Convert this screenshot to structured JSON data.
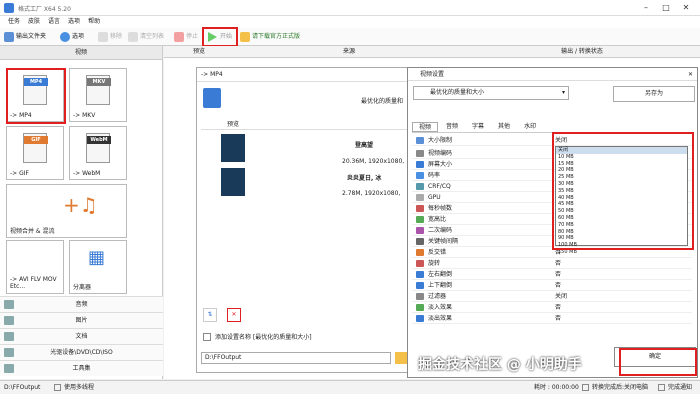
{
  "app": {
    "title": "格式工厂 X64 5.20"
  },
  "menu": [
    "任务",
    "皮肤",
    "语言",
    "选项",
    "帮助"
  ],
  "toolbar": {
    "output_folder": "输出文件夹",
    "options": "选项",
    "remove": "移除",
    "clear_list": "清空列表",
    "stop": "停止",
    "start": "开始",
    "download": "请下载官方正式版"
  },
  "left": {
    "header": "视频",
    "tiles": [
      "-> MP4",
      "-> MKV",
      "-> GIF",
      "-> WebM",
      "视频合并 & 混流",
      "-> AVI FLV MOV Etc...",
      "分离器"
    ],
    "tile_badges": [
      "MP4",
      "MKV",
      "GIF",
      "WebM"
    ],
    "categories": [
      "音频",
      "图片",
      "文档",
      "光驱设备\\DVD\\CD\\ISO",
      "工具集"
    ]
  },
  "main": {
    "col_preview": "预览",
    "col_source": "来源",
    "col_output": "输出 / 转换状态"
  },
  "panel": {
    "title": "-> MP4",
    "quality": "最优化的质量和",
    "preview_col": "预览",
    "items": [
      {
        "title": "登高望",
        "meta": "20.36M, 1920x1080,"
      },
      {
        "title": "炎炎夏日, 冰",
        "meta": "2.78M, 1920x1080,"
      }
    ],
    "setting_label": "添加设置名称 [最优化的质量和大小]",
    "output_path": "D:\\FFOutput"
  },
  "dialog": {
    "title": "视频设置",
    "preset": "最优化的质量和大小",
    "save_as": "另存为",
    "tabs": [
      "视频",
      "音频",
      "字幕",
      "其他",
      "水印"
    ],
    "ok": "确定",
    "props": [
      {
        "name": "大小限制",
        "value": "关闭"
      },
      {
        "name": "视频编码",
        "value": ""
      },
      {
        "name": "屏幕大小",
        "value": ""
      },
      {
        "name": "码率",
        "value": ""
      },
      {
        "name": "CRF/CQ",
        "value": ""
      },
      {
        "name": "GPU",
        "value": ""
      },
      {
        "name": "每秒帧数",
        "value": ""
      },
      {
        "name": "宽高比",
        "value": ""
      },
      {
        "name": "二次编码",
        "value": ""
      },
      {
        "name": "关键帧间隔",
        "value": "默认"
      },
      {
        "name": "反交错",
        "value": "否"
      },
      {
        "name": "旋转",
        "value": "否"
      },
      {
        "name": "左右翻倒",
        "value": "否"
      },
      {
        "name": "上下翻倒",
        "value": "否"
      },
      {
        "name": "过滤器",
        "value": "关闭"
      },
      {
        "name": "淡入效果",
        "value": "否"
      },
      {
        "name": "淡出效果",
        "value": "否"
      }
    ],
    "dropdown": [
      "关闭",
      "10 MB",
      "15 MB",
      "20 MB",
      "25 MB",
      "30 MB",
      "35 MB",
      "40 MB",
      "45 MB",
      "50 MB",
      "60 MB",
      "70 MB",
      "80 MB",
      "90 MB",
      "100 MB",
      "150 MB"
    ]
  },
  "status": {
    "path": "D:\\FFOutput",
    "multithread": "使用多线程",
    "elapsed": "耗时 : 00:00:00",
    "shutdown": "转换完成后:关闭电脑",
    "notify": "完成通知"
  },
  "watermark": "掘金技术社区 @ 小明助手",
  "colors": {
    "red": "#e02020",
    "blue": "#3a7bd5"
  }
}
